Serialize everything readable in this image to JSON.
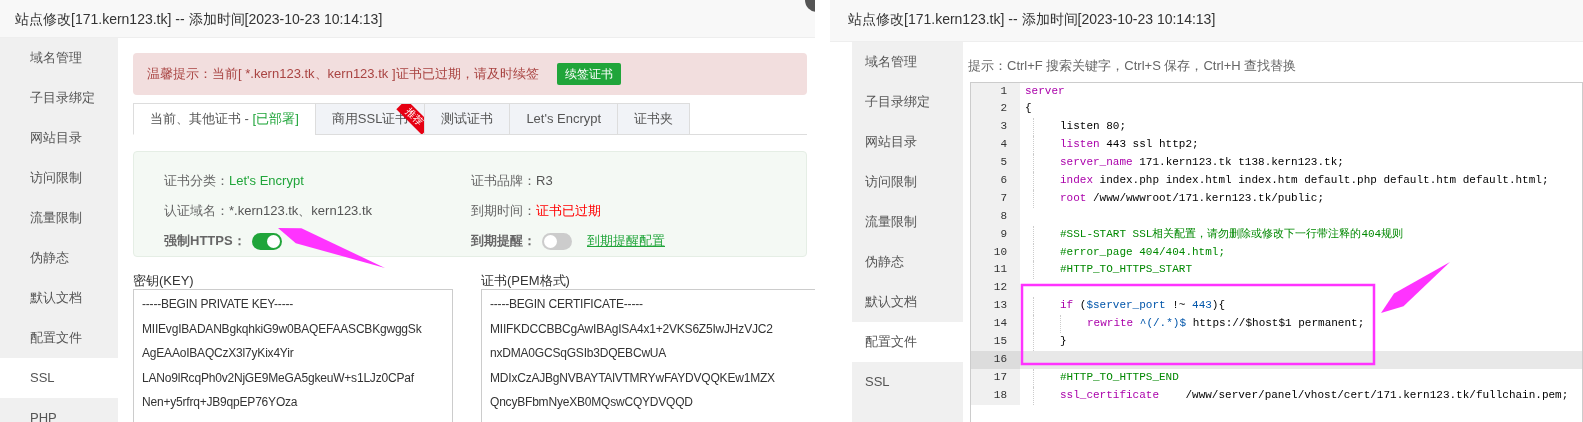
{
  "left_dialog": {
    "title": "站点修改[171.kern123.tk] -- 添加时间[2023-10-23 10:14:13]",
    "sidebar": {
      "items": [
        {
          "label": "域名管理",
          "selected": false
        },
        {
          "label": "子目录绑定",
          "selected": false
        },
        {
          "label": "网站目录",
          "selected": false
        },
        {
          "label": "访问限制",
          "selected": false
        },
        {
          "label": "流量限制",
          "selected": false
        },
        {
          "label": "伪静态",
          "selected": false
        },
        {
          "label": "默认文档",
          "selected": false
        },
        {
          "label": "配置文件",
          "selected": false
        },
        {
          "label": "SSL",
          "selected": true
        },
        {
          "label": "PHP",
          "selected": false
        }
      ]
    },
    "alert": {
      "text": "温馨提示：当前[ *.kern123.tk、kern123.tk ]证书已过期，请及时续签",
      "button": "续签证书"
    },
    "tabs": [
      {
        "label": "当前、其他证书 - ",
        "status": "[已部署]",
        "selected": true
      },
      {
        "label": "商用SSL证书",
        "badge": "推荐",
        "selected": false
      },
      {
        "label": "测试证书",
        "selected": false
      },
      {
        "label": "Let's Encrypt",
        "selected": false
      },
      {
        "label": "证书夹",
        "selected": false
      }
    ],
    "cert_info": [
      {
        "kind": "text",
        "label": "证书分类：",
        "value": "Let's Encrypt",
        "color": "#20a53a"
      },
      {
        "kind": "text",
        "label": "证书品牌：",
        "value": "R3"
      },
      {
        "kind": "text",
        "label": "认证域名：",
        "value": "*.kern123.tk、kern123.tk"
      },
      {
        "kind": "text",
        "label": "到期时间：",
        "value": "证书已过期",
        "color": "#ff0000"
      },
      {
        "kind": "toggle",
        "label": "强制HTTPS：",
        "on": true
      },
      {
        "kind": "toggle",
        "label": "到期提醒：",
        "on": false,
        "link": "到期提醒配置"
      }
    ],
    "key": {
      "label": "密钥(KEY)",
      "lines": [
        "-----BEGIN PRIVATE KEY-----",
        "MIIEvgIBADANBgkqhkiG9w0BAQEFAASCBKgwggSk",
        "AgEAAoIBAQCzX3l7yKix4Yir",
        "LANo9lRcqPh0v2NjGE9MeGA5gkeuW+s1LJz0CPaf",
        "Nen+y5rfrq+JB9qpEP76YOza"
      ]
    },
    "certificate": {
      "label": "证书(PEM格式)",
      "lines": [
        "-----BEGIN CERTIFICATE-----",
        "MIIFKDCCBBCgAwIBAgISA4x1+2VKS6Z5IwJHzVJC2",
        "nxDMA0GCSqGSIb3DQEBCwUA",
        "MDIxCzAJBgNVBAYTAlVTMRYwFAYDVQQKEw1MZX",
        "QncyBFbmNyeXB0MQswCQYDVQQD"
      ]
    }
  },
  "right_dialog": {
    "title": "站点修改[171.kern123.tk] -- 添加时间[2023-10-23 10:14:13]",
    "sidebar": {
      "items": [
        {
          "label": "域名管理",
          "selected": false
        },
        {
          "label": "子目录绑定",
          "selected": false
        },
        {
          "label": "网站目录",
          "selected": false
        },
        {
          "label": "访问限制",
          "selected": false
        },
        {
          "label": "流量限制",
          "selected": false
        },
        {
          "label": "伪静态",
          "selected": false
        },
        {
          "label": "默认文档",
          "selected": false
        },
        {
          "label": "配置文件",
          "selected": true
        },
        {
          "label": "SSL",
          "selected": false
        }
      ]
    },
    "hint": "提示：Ctrl+F 搜索关键字，Ctrl+S 保存，Ctrl+H 查找替换",
    "editor": {
      "lines": [
        {
          "number": "1",
          "active": false,
          "tokens": [
            {
              "kind": "keyword",
              "text": "server"
            }
          ]
        },
        {
          "number": "2",
          "active": false,
          "tokens": [
            {
              "kind": "plain",
              "text": "{"
            }
          ]
        },
        {
          "number": "3",
          "active": false,
          "tokens": [
            {
              "kind": "plain",
              "text": "    listen 80;"
            }
          ]
        },
        {
          "number": "4",
          "active": false,
          "tokens": [
            {
              "kind": "keyword",
              "text": "    listen"
            },
            {
              "kind": "plain",
              "text": " 443 ssl http2;"
            }
          ]
        },
        {
          "number": "5",
          "active": false,
          "tokens": [
            {
              "kind": "keyword",
              "text": "    server_name"
            },
            {
              "kind": "plain",
              "text": " 171.kern123.tk t138.kern123.tk;"
            }
          ]
        },
        {
          "number": "6",
          "active": false,
          "tokens": [
            {
              "kind": "keyword",
              "text": "    index"
            },
            {
              "kind": "plain",
              "text": " index.php index.html index.htm default.php default.htm default.html;"
            }
          ]
        },
        {
          "number": "7",
          "active": false,
          "tokens": [
            {
              "kind": "keyword",
              "text": "    root"
            },
            {
              "kind": "plain",
              "text": " /www/wwwroot/171.kern123.tk/public;"
            }
          ]
        },
        {
          "number": "8",
          "active": false
        },
        {
          "number": "9",
          "active": false,
          "tokens": [
            {
              "kind": "comment",
              "text": "    #SSL-START SSL相关配置，请勿删除或修改下一行带注释的404规则"
            }
          ]
        },
        {
          "number": "10",
          "active": false,
          "tokens": [
            {
              "kind": "comment",
              "text": "    #error_page 404/404.html;"
            }
          ]
        },
        {
          "number": "11",
          "active": false,
          "tokens": [
            {
              "kind": "comment",
              "text": "    #HTTP_TO_HTTPS_START"
            }
          ]
        },
        {
          "number": "12",
          "active": false
        },
        {
          "number": "13",
          "active": false,
          "tokens": [
            {
              "kind": "keyword",
              "text": "    if"
            },
            {
              "kind": "plain",
              "text": " ("
            },
            {
              "kind": "variable",
              "text": "$server_port"
            },
            {
              "kind": "plain",
              "text": " !~ "
            },
            {
              "kind": "variable",
              "text": "443"
            },
            {
              "kind": "plain",
              "text": "){"
            }
          ]
        },
        {
          "number": "14",
          "active": false,
          "tokens": [
            {
              "kind": "keyword",
              "text": "        rewrite"
            },
            {
              "kind": "variable",
              "text": " ^(/.*)$"
            },
            {
              "kind": "plain",
              "text": " https://$host$1 permanent;"
            }
          ]
        },
        {
          "number": "15",
          "active": false,
          "tokens": [
            {
              "kind": "plain",
              "text": "    }"
            }
          ]
        },
        {
          "number": "16",
          "active": true
        },
        {
          "number": "17",
          "active": false,
          "tokens": [
            {
              "kind": "comment",
              "text": "    #HTTP_TO_HTTPS_END"
            }
          ]
        },
        {
          "number": "18",
          "active": false,
          "tokens": [
            {
              "kind": "keyword",
              "text": "    ssl_certificate"
            },
            {
              "kind": "plain",
              "text": "    /www/server/panel/vhost/cert/171.kern123.tk/fullchain.pem;"
            }
          ]
        }
      ]
    }
  }
}
